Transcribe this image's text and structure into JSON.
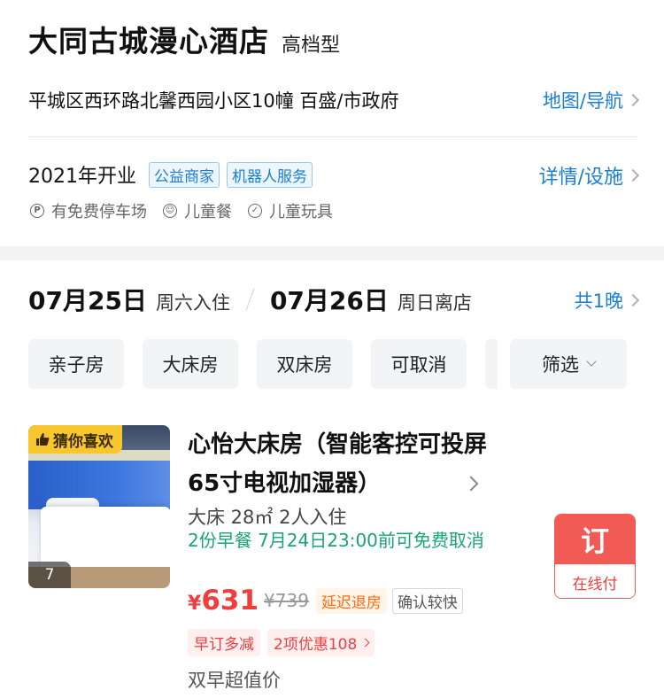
{
  "hotel": {
    "name": "大同古城漫心酒店",
    "type": "高档型",
    "address": "平城区西环路北馨西园小区10幢 百盛/市政府",
    "map_link": "地图/导航",
    "opened": "2021年开业",
    "tags": [
      "公益商家",
      "机器人服务"
    ],
    "details_link": "详情/设施",
    "amenities": [
      {
        "icon": "parking-icon",
        "label": "有免费停车场"
      },
      {
        "icon": "kids-meal-icon",
        "label": "儿童餐"
      },
      {
        "icon": "check-circle-icon",
        "label": "儿童玩具"
      }
    ]
  },
  "dates": {
    "checkin_date": "07月25日",
    "checkin_label": "周六入住",
    "checkout_date": "07月26日",
    "checkout_label": "周日离店",
    "nights": "共1晚"
  },
  "filters": {
    "chips": [
      "亲子房",
      "大床房",
      "双床房",
      "可取消"
    ],
    "filter_label": "筛选"
  },
  "room": {
    "badge": "猜你喜欢",
    "photo_count": "7",
    "title": "心怡大床房（智能客控可投屏65寸电视加湿器）",
    "spec": "大床 28㎡ 2人入住",
    "policy": "2份早餐 7月24日23:00前可免费取消",
    "currency": "¥",
    "price": "631",
    "original_price": "¥739",
    "tag_late_checkout": "延迟退房",
    "tag_confirm": "确认较快",
    "promos": [
      "早订多减",
      "2项优惠108"
    ],
    "note": "双早超值价",
    "book_label": "订",
    "book_sub": "在线付"
  },
  "colors": {
    "link_blue": "#1a7fd4",
    "price_red": "#f03e3e",
    "policy_green": "#1aa37a",
    "badge_yellow": "#f7c72d",
    "book_red": "#f25b55"
  }
}
